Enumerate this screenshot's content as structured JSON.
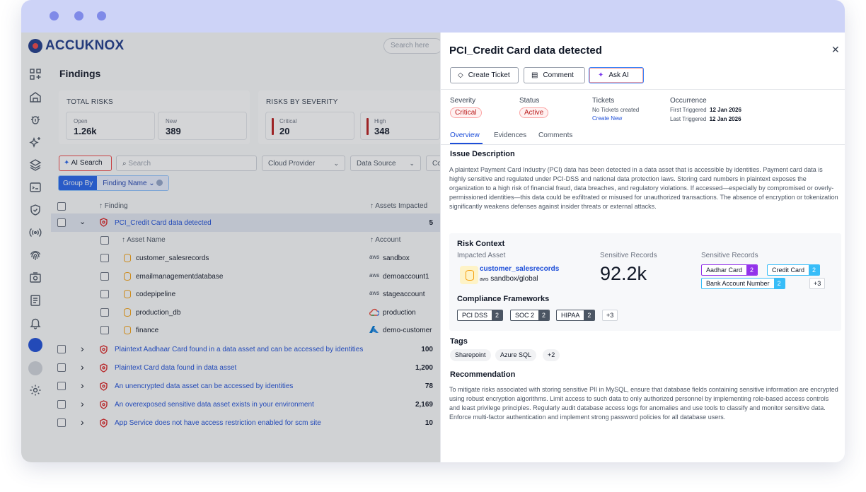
{
  "app": {
    "brand": "ACCUKNOX",
    "search_placeholder": "Search here",
    "page_title": "Findings"
  },
  "total_risks": {
    "heading": "TOTAL RISKS",
    "open_label": "Open",
    "open_value": "1.26k",
    "new_label": "New",
    "new_value": "389"
  },
  "risks_by_severity": {
    "heading": "RISKS BY SEVERITY",
    "critical_label": "Critical",
    "critical_value": "20",
    "high_label": "High",
    "high_value": "348"
  },
  "filters": {
    "ai_search": "AI Search",
    "search_placeholder": "Search",
    "cloud_provider": "Cloud Provider",
    "data_source": "Data Source",
    "cut_off": "Co",
    "group_by": "Group By",
    "group_value": "Finding Name"
  },
  "table": {
    "col_finding": "Finding",
    "col_assets": "Assets Impacted",
    "expanded_row": {
      "title": "PCI_Credit Card data detected",
      "count": "5"
    },
    "sub_col_asset": "Asset Name",
    "sub_col_account": "Account",
    "sub_rows": [
      {
        "name": "customer_salesrecords",
        "account": "sandbox",
        "acct_icon": "aws"
      },
      {
        "name": "emailmanagementdatabase",
        "account": "demoaccount1",
        "acct_icon": "aws"
      },
      {
        "name": "codepipeline",
        "account": "stageaccount",
        "acct_icon": "aws"
      },
      {
        "name": "production_db",
        "account": "production",
        "acct_icon": "gcp"
      },
      {
        "name": "finance",
        "account": "demo-customer",
        "acct_icon": "azure"
      }
    ],
    "rows": [
      {
        "title": "Plaintext Aadhaar Card found in a data asset and can be accessed by identities",
        "count": "100"
      },
      {
        "title": "Plaintext Card data found in data asset",
        "count": "1,200"
      },
      {
        "title": "An unencrypted data asset can be accessed by identities",
        "count": "78"
      },
      {
        "title": "An overexposed sensitive data asset exists in your environment",
        "count": "2,169"
      },
      {
        "title": "App Service does not have access restriction enabled for scm site",
        "count": "10"
      }
    ]
  },
  "drawer": {
    "title": "PCI_Credit Card data detected",
    "buttons": {
      "create_ticket": "Create Ticket",
      "comment": "Comment",
      "ask_ai": "Ask AI"
    },
    "severity_label": "Severity",
    "severity_value": "Critical",
    "status_label": "Status",
    "status_value": "Active",
    "tickets_label": "Tickets",
    "tickets_none": "No Tickets created",
    "tickets_create": "Create New",
    "occurrence_label": "Occurrence",
    "first_triggered_label": "First Triggered",
    "first_triggered_value": "12 Jan 2026",
    "last_triggered_label": "Last Triggered",
    "last_triggered_value": "12 Jan 2026",
    "tabs": [
      "Overview",
      "Evidences",
      "Comments"
    ],
    "issue_title": "Issue Description",
    "issue_text": "A plaintext Payment Card Industry (PCI) data has been detected in a data asset that is accessible by identities. Payment card data is highly sensitive and regulated under PCI-DSS and national data protection laws. Storing card numbers in plaintext exposes the organization to a high risk of financial fraud, data breaches, and regulatory violations. If accessed—especially by compromised or overly-permissioned identities—this data could be exfiltrated or misused for unauthorized transactions. The absence of encryption or tokenization significantly weakens defenses against insider threats or external attacks.",
    "risk_context": {
      "title": "Risk Context",
      "impacted_label": "Impacted Asset",
      "asset_name": "customer_salesrecords",
      "asset_region": "sandbox/global",
      "records_label": "Sensitive Records",
      "records_value": "92.2k",
      "types_label": "Sensitive Records",
      "types": [
        {
          "label": "Aadhar Card",
          "count": "2",
          "color": "#9333ea"
        },
        {
          "label": "Credit Card",
          "count": "2",
          "color": "#38bdf8"
        },
        {
          "label": "Bank Account Number",
          "count": "2",
          "color": "#38bdf8"
        }
      ],
      "types_more": "+3",
      "frameworks_title": "Compliance Frameworks",
      "frameworks": [
        {
          "label": "PCI DSS",
          "count": "2"
        },
        {
          "label": "SOC 2",
          "count": "2"
        },
        {
          "label": "HIPAA",
          "count": "2"
        }
      ],
      "frameworks_more": "+3"
    },
    "tags_title": "Tags",
    "tags": [
      "Sharepoint",
      "Azure SQL",
      "+2"
    ],
    "recommendation_title": "Recommendation",
    "recommendation_text": "To mitigate risks associated with storing sensitive PII in MySQL, ensure that database fields containing sensitive information are encrypted using robust encryption algorithms. Limit access to such data to only authorized personnel by implementing role-based access controls and least privilege principles. Regularly audit database access logs for anomalies and use tools to classify and monitor sensitive data. Enforce multi-factor authentication and implement strong password policies for all database users."
  }
}
